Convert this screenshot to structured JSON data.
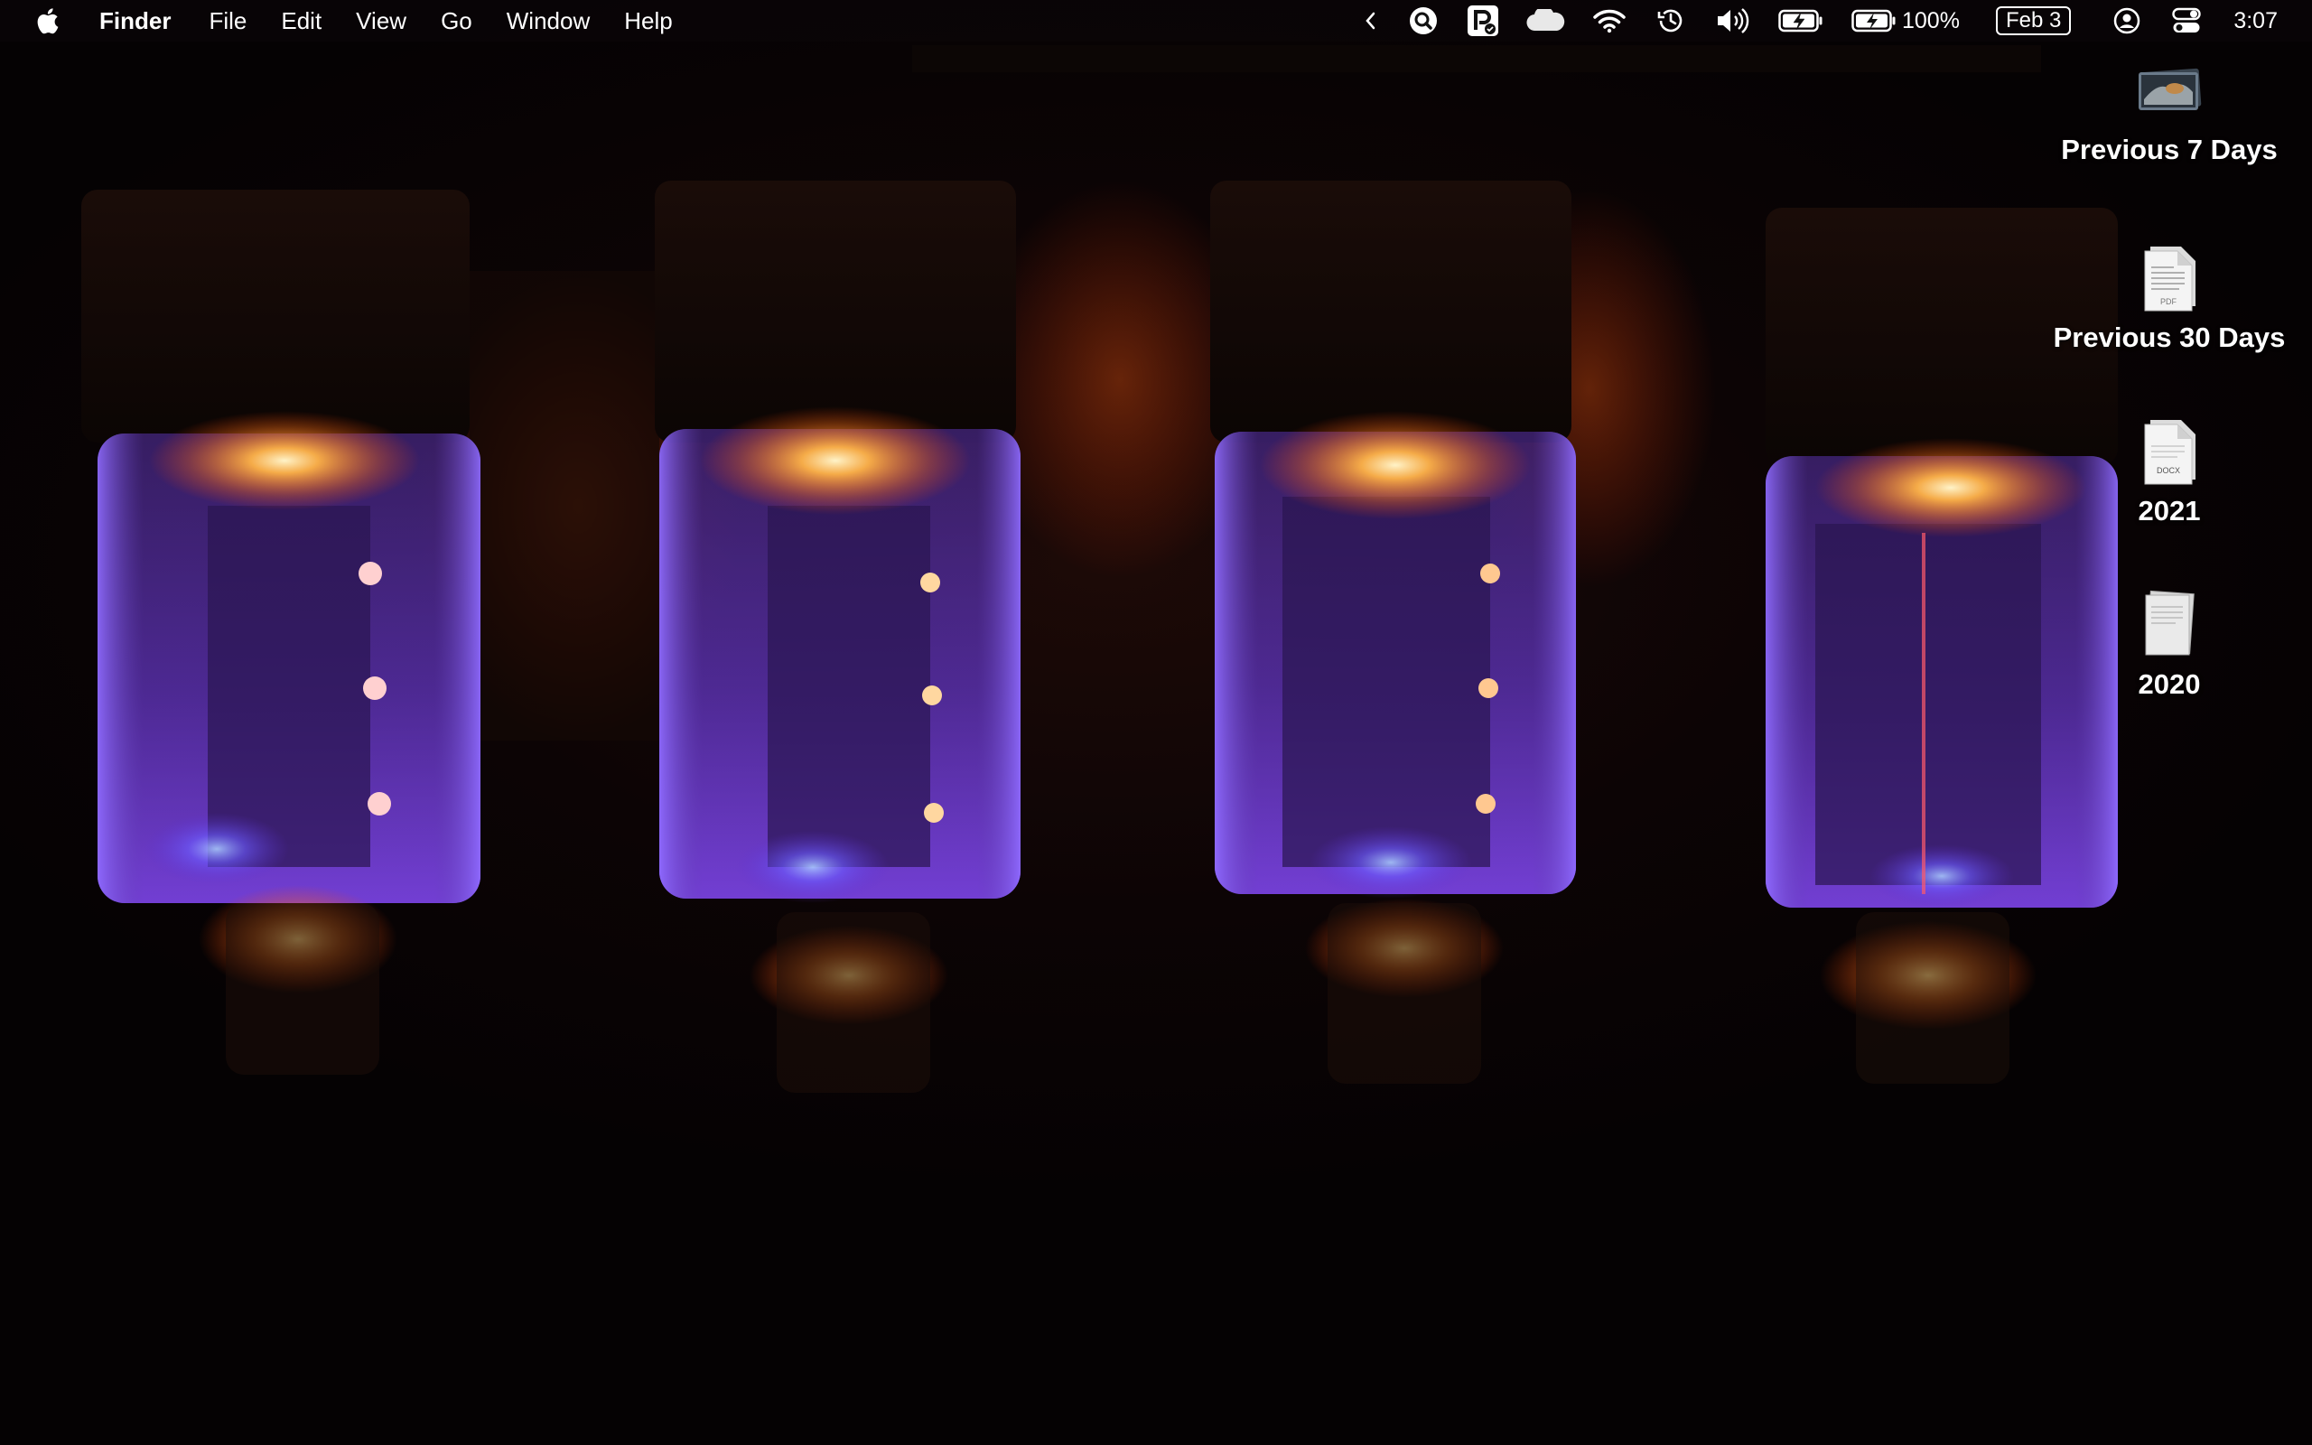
{
  "menubar": {
    "app_name": "Finder",
    "menus": [
      "File",
      "Edit",
      "View",
      "Go",
      "Window",
      "Help"
    ],
    "status": {
      "battery_percent": "100%",
      "date": "Feb 3",
      "time": "3:07"
    },
    "status_icons": [
      "chevron-left-icon",
      "search-magnifier-icon",
      "p-app-icon",
      "cloud-icon",
      "wifi-icon",
      "time-machine-icon",
      "volume-icon",
      "battery-charging-icon",
      "battery-charging-icon",
      "user-icon",
      "control-center-icon"
    ]
  },
  "desktop": {
    "icons": [
      {
        "label": "Previous 7 Days",
        "kind": "folder-stack-photo"
      },
      {
        "label": "Previous 30 Days",
        "kind": "pdf",
        "badge": "PDF"
      },
      {
        "label": "2021",
        "kind": "docx",
        "badge": "DOCX"
      },
      {
        "label": "2020",
        "kind": "document"
      }
    ],
    "wallpaper": "vacuum-tubes-glowing"
  },
  "colors": {
    "menubar_bg": "#0c0608",
    "tube_glow": "#ff9a3a",
    "tube_plasma": "#7a3cff"
  }
}
